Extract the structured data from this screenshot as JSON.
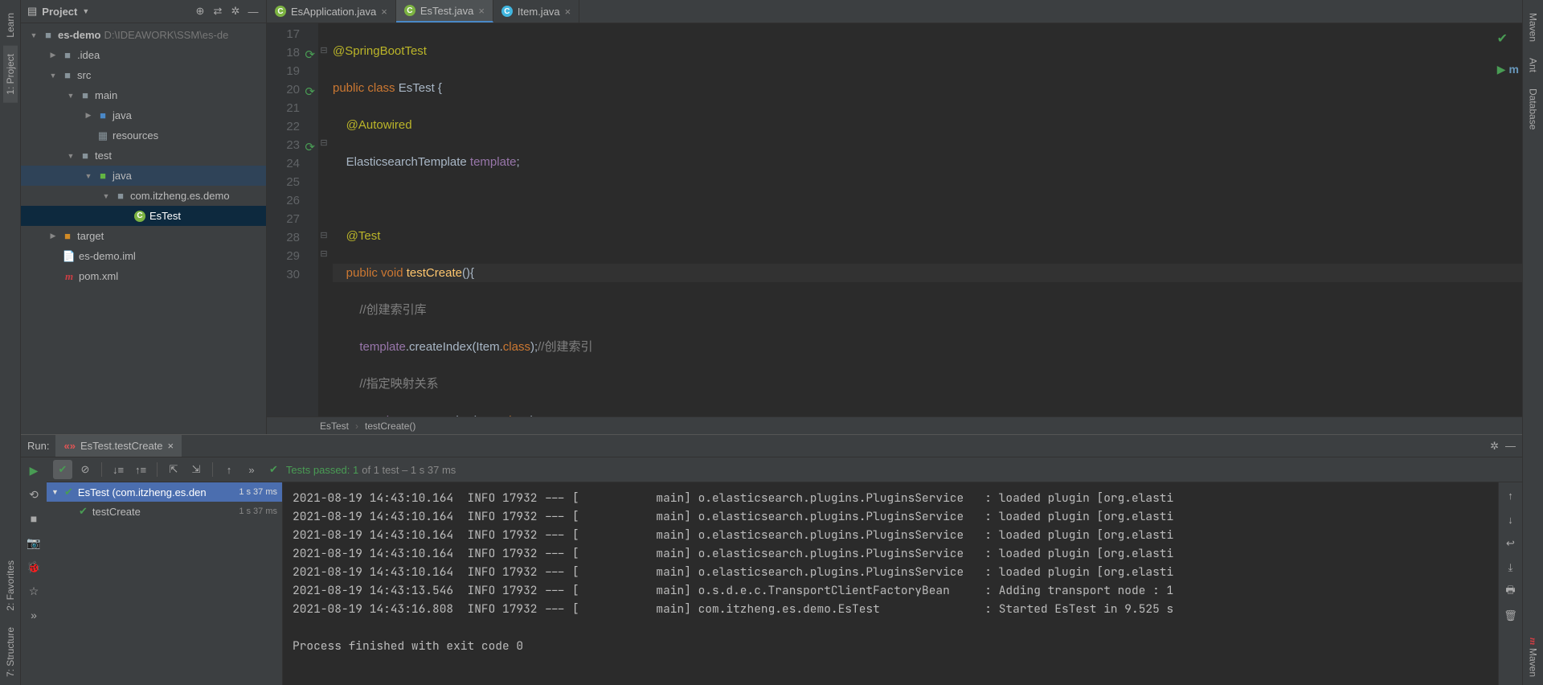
{
  "left_tabs": {
    "learn": "Learn",
    "project": "1: Project",
    "favorites": "2: Favorites",
    "structure": "7: Structure"
  },
  "right_tabs": {
    "maven_top": "Maven",
    "ant": "Ant",
    "database": "Database",
    "maven": "Maven"
  },
  "project": {
    "title": "Project",
    "root": {
      "name": "es-demo",
      "path": "D:\\IDEAWORK\\SSM\\es-de"
    },
    "tree": {
      "idea": ".idea",
      "src": "src",
      "main": "main",
      "main_java": "java",
      "resources": "resources",
      "test": "test",
      "test_java": "java",
      "pkg": "com.itzheng.es.demo",
      "estest": "EsTest",
      "target": "target",
      "iml": "es-demo.iml",
      "pom": "pom.xml"
    }
  },
  "tabs": [
    {
      "name": "EsApplication.java",
      "icon": "green"
    },
    {
      "name": "EsTest.java",
      "icon": "green",
      "active": true
    },
    {
      "name": "Item.java",
      "icon": "blue"
    }
  ],
  "code": {
    "l17": "@SpringBootTest",
    "l18_a": "public",
    "l18_b": "class",
    "l18_c": "EsTest {",
    "l19": "@Autowired",
    "l20_a": "ElasticsearchTemplate",
    "l20_b": "template",
    "l20_c": ";",
    "l22": "@Test",
    "l23_a": "public",
    "l23_b": "void",
    "l23_c": "testCreate",
    "l23_d": "(){",
    "l24": "//创建索引库",
    "l25_a": "template",
    "l25_b": ".createIndex(Item.",
    "l25_c": "class",
    "l25_d": ");",
    "l25_e": "//创建索引",
    "l26": "//指定映射关系",
    "l27_a": "template",
    "l27_b": ".putMapping(Item.",
    "l27_c": "class",
    "l27_d": ");",
    "l28": "}",
    "l29": "}",
    "lines": [
      "17",
      "18",
      "19",
      "20",
      "21",
      "22",
      "23",
      "24",
      "25",
      "26",
      "27",
      "28",
      "29",
      "30"
    ]
  },
  "breadcrumb": {
    "a": "EsTest",
    "b": "testCreate()"
  },
  "run": {
    "label": "Run:",
    "tab": "EsTest.testCreate",
    "tests_passed": "Tests passed: 1",
    "tests_rest": " of 1 test – 1 s 37 ms",
    "tree_root": "EsTest (com.itzheng.es.den",
    "tree_root_time": "1 s 37 ms",
    "tree_item": "testCreate",
    "tree_item_time": "1 s 37 ms"
  },
  "console_lines": [
    "2021-08-19 14:43:10.164  INFO 17932 --- [           main] o.elasticsearch.plugins.PluginsService   : loaded plugin [org.elasti",
    "2021-08-19 14:43:10.164  INFO 17932 --- [           main] o.elasticsearch.plugins.PluginsService   : loaded plugin [org.elasti",
    "2021-08-19 14:43:10.164  INFO 17932 --- [           main] o.elasticsearch.plugins.PluginsService   : loaded plugin [org.elasti",
    "2021-08-19 14:43:10.164  INFO 17932 --- [           main] o.elasticsearch.plugins.PluginsService   : loaded plugin [org.elasti",
    "2021-08-19 14:43:10.164  INFO 17932 --- [           main] o.elasticsearch.plugins.PluginsService   : loaded plugin [org.elasti",
    "2021-08-19 14:43:13.546  INFO 17932 --- [           main] o.s.d.e.c.TransportClientFactoryBean     : Adding transport node : 1",
    "2021-08-19 14:43:16.808  INFO 17932 --- [           main] com.itzheng.es.demo.EsTest               : Started EsTest in 9.525 s",
    "",
    "Process finished with exit code 0"
  ]
}
